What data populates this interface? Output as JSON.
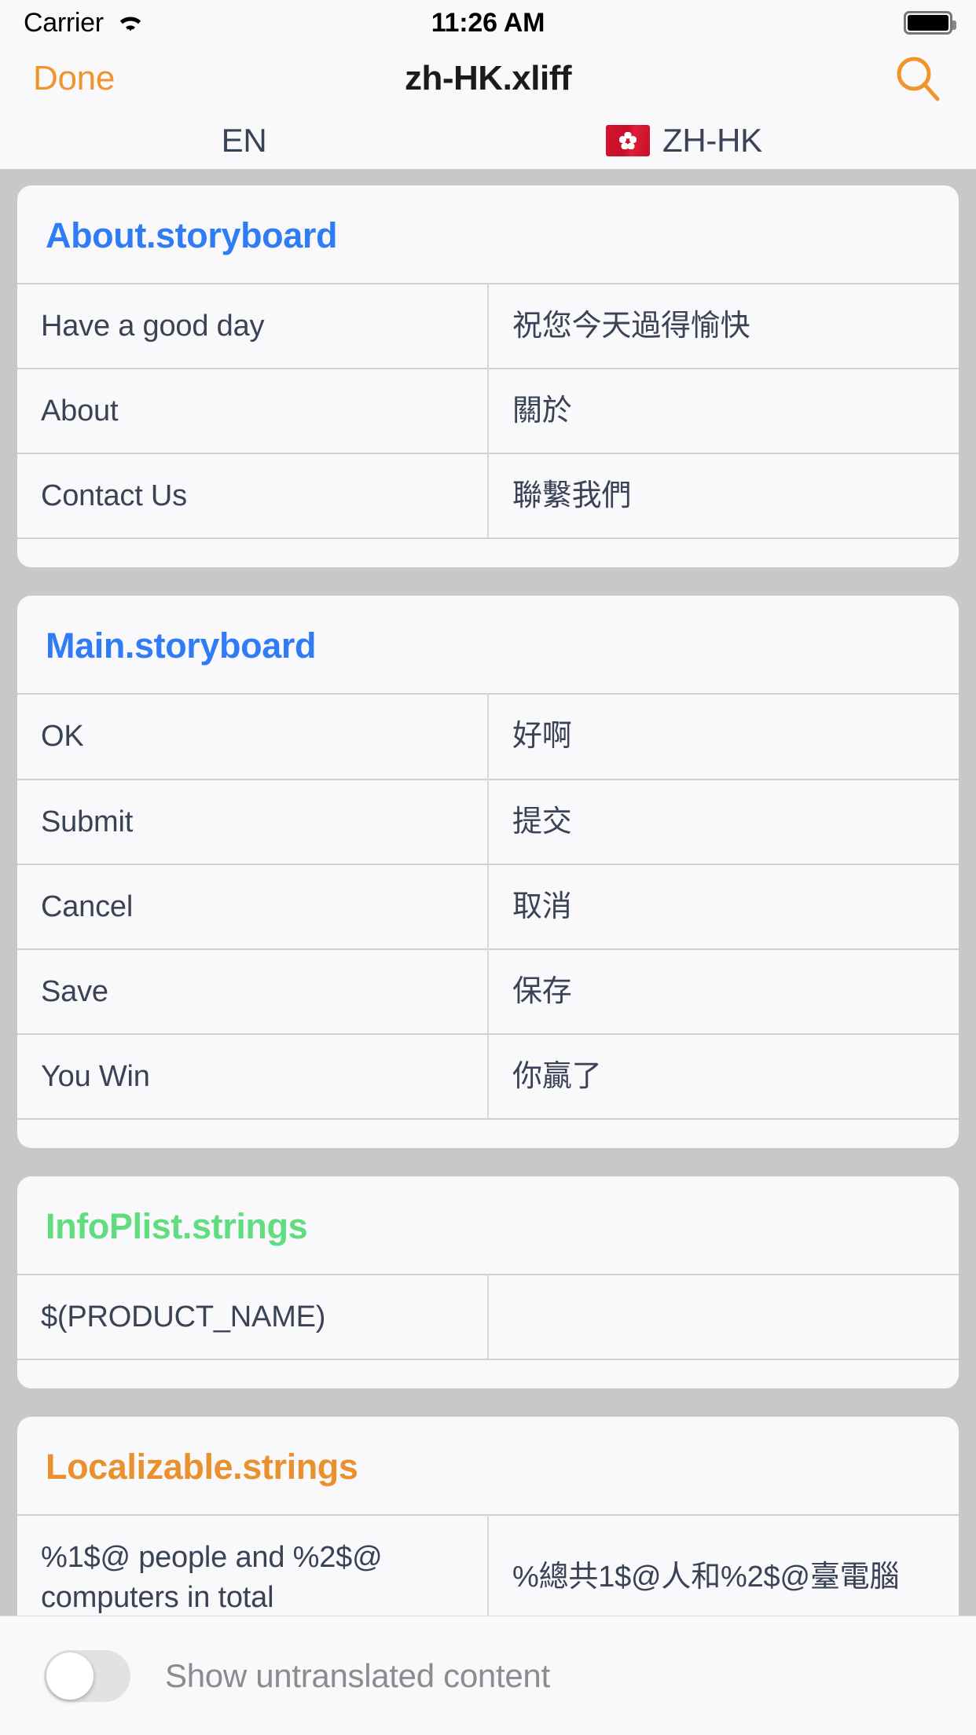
{
  "status_bar": {
    "carrier": "Carrier",
    "time": "11:26 AM",
    "wifi_icon": "wifi-icon",
    "battery_icon": "battery-full-icon"
  },
  "nav_bar": {
    "done_label": "Done",
    "title": "zh-HK.xliff",
    "search_icon": "search-icon",
    "accent_color": "#f0942c"
  },
  "language_header": {
    "source_language": "EN",
    "target_flag": "flag-hong-kong-icon",
    "target_language": "ZH-HK"
  },
  "sections": [
    {
      "file": "About.storyboard",
      "color_class": "c-blue",
      "color": "#2f7cf6",
      "rows": [
        {
          "source": "Have a good day",
          "target": "祝您今天過得愉快"
        },
        {
          "source": "About",
          "target": "關於"
        },
        {
          "source": "Contact Us",
          "target": "聯繫我們"
        }
      ]
    },
    {
      "file": "Main.storyboard",
      "color_class": "c-blue",
      "color": "#2f7cf6",
      "rows": [
        {
          "source": "OK",
          "target": "好啊"
        },
        {
          "source": "Submit",
          "target": "提交"
        },
        {
          "source": "Cancel",
          "target": "取消"
        },
        {
          "source": "Save",
          "target": "保存"
        },
        {
          "source": "You Win",
          "target": "你贏了"
        }
      ]
    },
    {
      "file": "InfoPlist.strings",
      "color_class": "c-green",
      "color": "#5fdd7f",
      "rows": [
        {
          "source": "$(PRODUCT_NAME)",
          "target": ""
        }
      ]
    },
    {
      "file": "Localizable.strings",
      "color_class": "c-orange",
      "color": "#e8912e",
      "rows": [
        {
          "source": "%1$@ people and %2$@ computers in total",
          "target": "%總共1$@人和%2$@臺電腦"
        }
      ]
    }
  ],
  "bottom_bar": {
    "toggle_label": "Show untranslated content",
    "toggle_state": "off"
  }
}
